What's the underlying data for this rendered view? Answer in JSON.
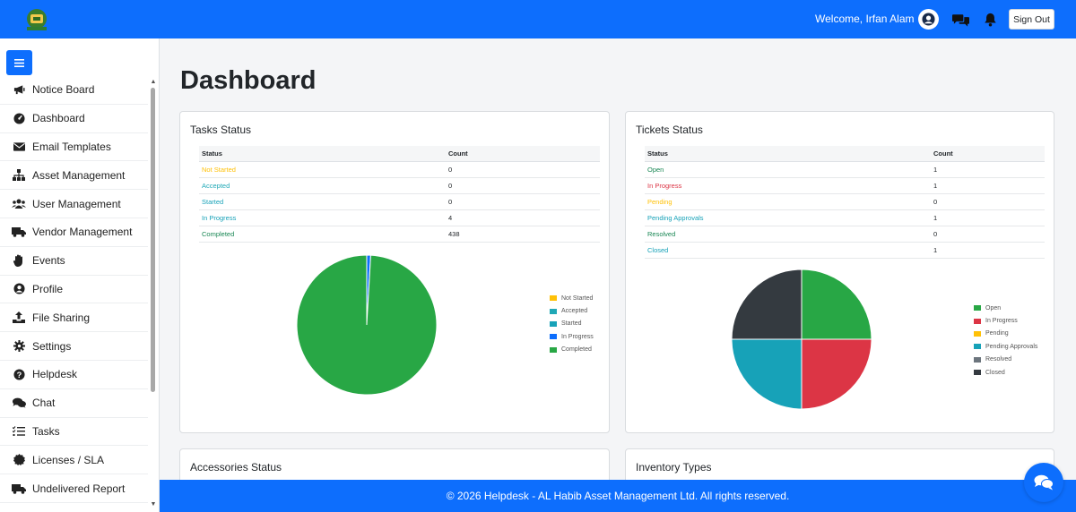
{
  "header": {
    "welcome": "Welcome, Irfan Alam",
    "sign_out": "Sign Out"
  },
  "sidebar": {
    "items": [
      {
        "label": "Notice Board",
        "icon": "megaphone-icon"
      },
      {
        "label": "Dashboard",
        "icon": "dashboard-icon"
      },
      {
        "label": "Email Templates",
        "icon": "envelope-icon"
      },
      {
        "label": "Asset Management",
        "icon": "sitemap-icon"
      },
      {
        "label": "User Management",
        "icon": "users-icon"
      },
      {
        "label": "Vendor Management",
        "icon": "truck-icon"
      },
      {
        "label": "Events",
        "icon": "hand-icon"
      },
      {
        "label": "Profile",
        "icon": "user-circle-icon"
      },
      {
        "label": "File Sharing",
        "icon": "upload-icon"
      },
      {
        "label": "Settings",
        "icon": "gear-icon"
      },
      {
        "label": "Helpdesk",
        "icon": "question-icon"
      },
      {
        "label": "Chat",
        "icon": "chat-icon"
      },
      {
        "label": "Tasks",
        "icon": "list-check-icon"
      },
      {
        "label": "Licenses / SLA",
        "icon": "certificate-icon"
      },
      {
        "label": "Undelivered Report",
        "icon": "truck-icon"
      }
    ]
  },
  "main": {
    "title": "Dashboard",
    "tasks_card": {
      "title": "Tasks Status",
      "col_status": "Status",
      "col_count": "Count",
      "rows": [
        {
          "status": "Not Started",
          "count": "0"
        },
        {
          "status": "Accepted",
          "count": "0"
        },
        {
          "status": "Started",
          "count": "0"
        },
        {
          "status": "In Progress",
          "count": "4"
        },
        {
          "status": "Completed",
          "count": "438"
        }
      ]
    },
    "tickets_card": {
      "title": "Tickets Status",
      "col_status": "Status",
      "col_count": "Count",
      "rows": [
        {
          "status": "Open",
          "count": "1"
        },
        {
          "status": "In Progress",
          "count": "1"
        },
        {
          "status": "Pending",
          "count": "0"
        },
        {
          "status": "Pending Approvals",
          "count": "1"
        },
        {
          "status": "Resolved",
          "count": "0"
        },
        {
          "status": "Closed",
          "count": "1"
        }
      ]
    },
    "accessories_card": {
      "title": "Accessories Status"
    },
    "inventory_card": {
      "title": "Inventory Types"
    }
  },
  "footer": {
    "text": "© 2026 Helpdesk - AL Habib Asset Management Ltd. All rights reserved."
  },
  "colors": {
    "primary": "#0d6efd",
    "not_started": "#ffc107",
    "accepted": "#20a8b6",
    "started": "#17a2b8",
    "in_progress": "#0d6efd",
    "completed": "#28a745",
    "open": "#28a745",
    "tickets_in_progress": "#dc3545",
    "pending": "#ffc107",
    "pending_approvals": "#17a2b8",
    "resolved": "#6c757d",
    "closed": "#343a40"
  },
  "chart_data": [
    {
      "type": "pie",
      "categories": [
        "Not Started",
        "Accepted",
        "Started",
        "In Progress",
        "Completed"
      ],
      "values": [
        0,
        0,
        0,
        4,
        438
      ],
      "colors": [
        "#ffc107",
        "#20a8b6",
        "#17a2b8",
        "#0d6efd",
        "#28a745"
      ],
      "legend": "right"
    },
    {
      "type": "pie",
      "categories": [
        "Open",
        "In Progress",
        "Pending",
        "Pending Approvals",
        "Resolved",
        "Closed"
      ],
      "values": [
        1,
        1,
        0,
        1,
        0,
        1
      ],
      "colors": [
        "#28a745",
        "#dc3545",
        "#ffc107",
        "#17a2b8",
        "#6c757d",
        "#343a40"
      ],
      "legend": "right"
    }
  ]
}
